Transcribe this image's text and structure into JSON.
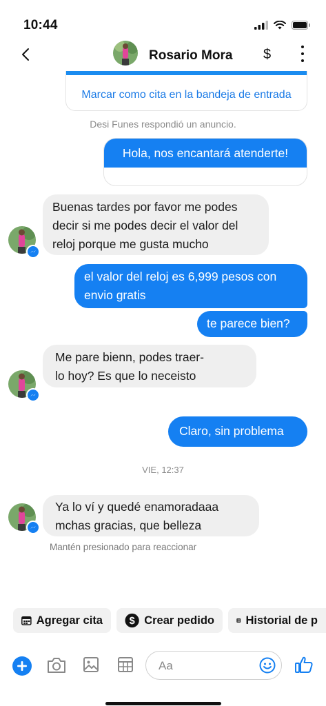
{
  "status_bar": {
    "time": "10:44"
  },
  "header": {
    "contact_name": "Rosario Mora",
    "dollar_symbol": "$"
  },
  "ad_card": {
    "link_label": "Marcar como cita en la bandeja de entrada"
  },
  "notes": {
    "replied_ad": "Desi Funes respondió un anuncio.",
    "timestamp": "VIE, 12:37",
    "hold_hint": "Mantén presionado para reaccionar"
  },
  "messages": [
    {
      "direction": "out",
      "lines": [
        "Hola, nos encantará atenderte!"
      ]
    },
    {
      "direction": "in",
      "lines": [
        "Buenas tardes por favor me podes",
        "decir si me podes decir el valor del",
        "reloj porque me gusta mucho"
      ]
    },
    {
      "direction": "out",
      "lines": [
        "el valor del reloj es 6,999 pesos con",
        "envio gratis"
      ]
    },
    {
      "direction": "out",
      "lines": [
        "te parece bien?"
      ]
    },
    {
      "direction": "in",
      "lines": [
        "Me pare bienn, podes traer-",
        "lo hoy? Es que lo neceisto"
      ]
    },
    {
      "direction": "out",
      "lines": [
        "Claro, sin problema"
      ]
    },
    {
      "direction": "in",
      "lines": [
        "Ya lo ví y quedé enamoradaaa",
        "mchas gracias, que belleza"
      ]
    }
  ],
  "quick_replies": [
    {
      "label": "Agregar cita",
      "icon": "calendar-icon"
    },
    {
      "label": "Crear pedido",
      "icon": "dollar-circle-icon"
    },
    {
      "label": "Historial de p",
      "icon": "list-icon"
    }
  ],
  "composer": {
    "placeholder": "Aa"
  },
  "colors": {
    "accent": "#1580f2",
    "incoming_bubble": "#efefef",
    "link": "#1a7ae6",
    "muted_text": "#8a8a8a"
  }
}
